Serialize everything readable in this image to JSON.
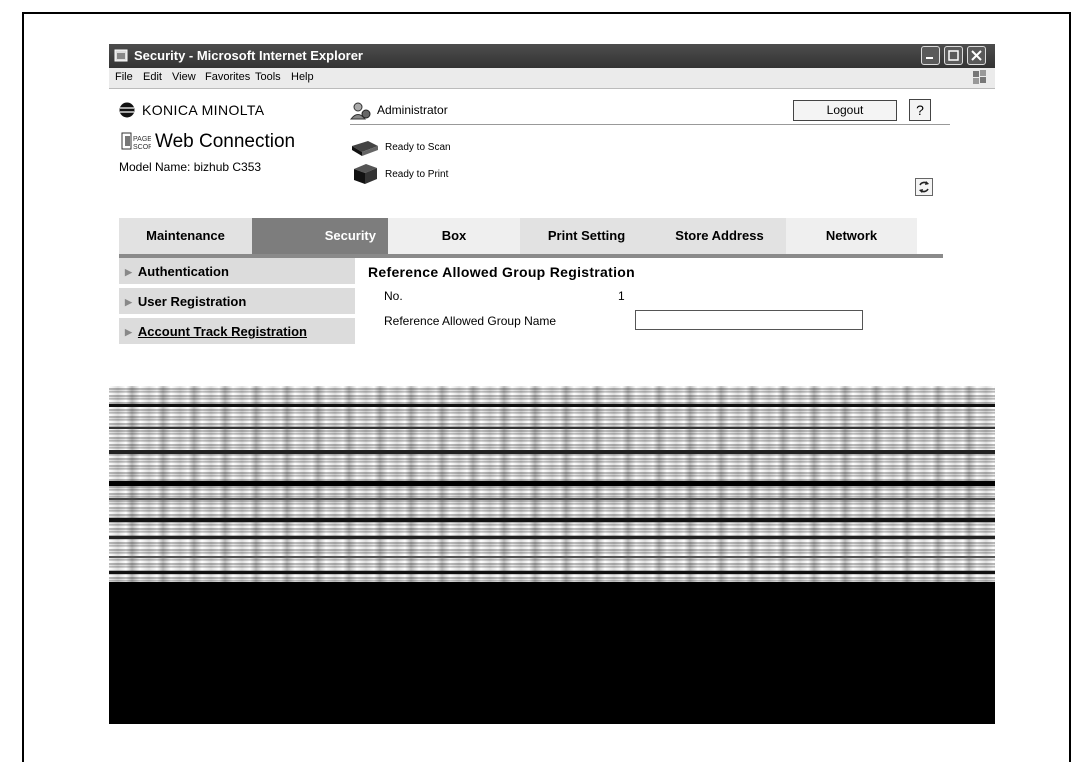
{
  "window": {
    "title": "Security - Microsoft Internet Explorer"
  },
  "menu": {
    "items": [
      "File",
      "Edit",
      "View",
      "Favorites",
      "Tools",
      "Help"
    ]
  },
  "header": {
    "brand": "KONICA MINOLTA",
    "product": "Web Connection",
    "pagescope": "PAGE SCOPE",
    "model_label": "Model Name: bizhub C353",
    "user": "Administrator",
    "logout_label": "Logout",
    "help_label": "?",
    "scan_status": "Ready to Scan",
    "print_status": "Ready to Print"
  },
  "tabs": [
    {
      "label": "Maintenance",
      "active": false
    },
    {
      "label": "Security",
      "active": true
    },
    {
      "label": "Box",
      "active": false
    },
    {
      "label": "Print Setting",
      "active": false
    },
    {
      "label": "Store Address",
      "active": false
    },
    {
      "label": "Network",
      "active": false
    }
  ],
  "sidebar": {
    "items": [
      {
        "label": "Authentication"
      },
      {
        "label": "User Registration"
      },
      {
        "label": "Account Track Registration"
      }
    ]
  },
  "main": {
    "title": "Reference Allowed Group Registration",
    "no_label": "No.",
    "no_value": "1",
    "name_label": "Reference Allowed Group Name",
    "name_value": ""
  },
  "colors": {
    "active_tab": "#7d7d7d",
    "inactive_tab": "#e2e2e2",
    "sidebar_bg": "#dcdcdc",
    "titlebar": "#3f3f3f"
  }
}
